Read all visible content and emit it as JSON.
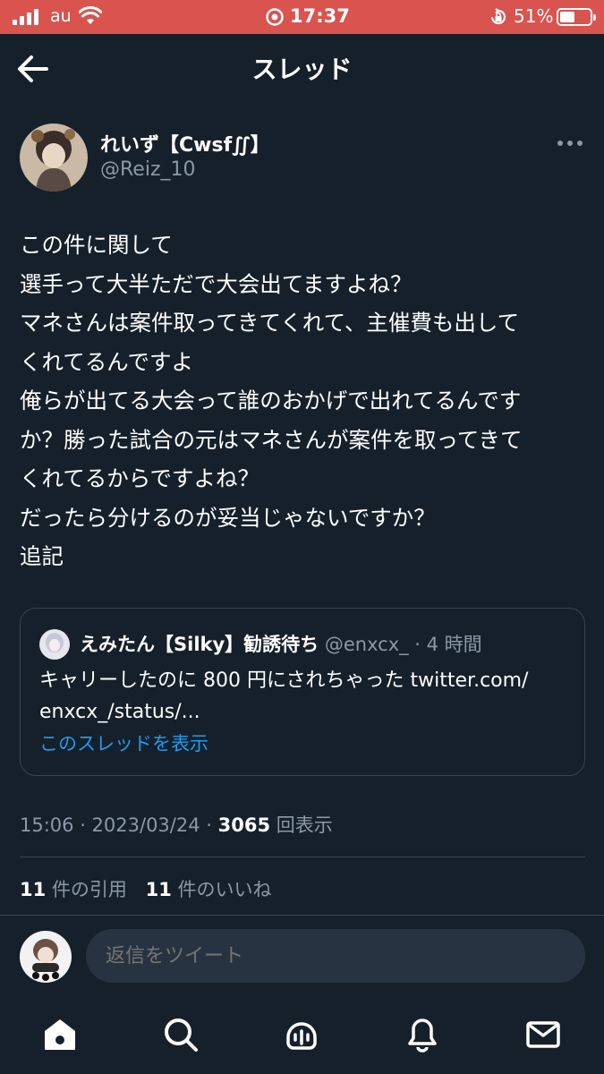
{
  "status_bar": {
    "carrier": "au",
    "time": "17:37",
    "battery": "51%",
    "battery_level": 0.51
  },
  "header": {
    "title": "スレッド"
  },
  "tweet": {
    "display_name": "れいず【Cwsf∬】",
    "handle": "@Reiz_10",
    "body": "この件に関して\n選手って大半ただで大会出てますよね？\nマネさんは案件取ってきてくれて、主催費も出して\nくれてるんですよ\n俺らが出てる大会って誰のおかげで出れてるんです\nか？勝った試合の元はマネさんが案件を取ってきて\nくれてるからですよね？\nだったら分けるのが妥当じゃないですか？\n追記",
    "quote": {
      "name": "えみたん【Silky】勧誘待ち",
      "meta": " @enxcx_ · 4 時間",
      "text": "キャリーしたのに 800 円にされちゃった twitter.com/\nenxcx_/status/...",
      "link": "このスレッドを表示"
    },
    "time": "15:06 · 2023/03/24 · ",
    "views_count": "3065",
    "views_label": " 回表示",
    "quotes_count": "11",
    "quotes_label": " 件の引用",
    "likes_count": "11",
    "likes_label": " 件のいいね"
  },
  "reply": {
    "placeholder": "返信をツイート"
  },
  "colors": {
    "background": "#15202b",
    "accent": "#1d9bf0",
    "status_bar": "#d9534f",
    "muted_text": "#8b98a5"
  },
  "nav": [
    "home-icon",
    "search-icon",
    "spaces-icon",
    "notifications-icon",
    "messages-icon"
  ]
}
